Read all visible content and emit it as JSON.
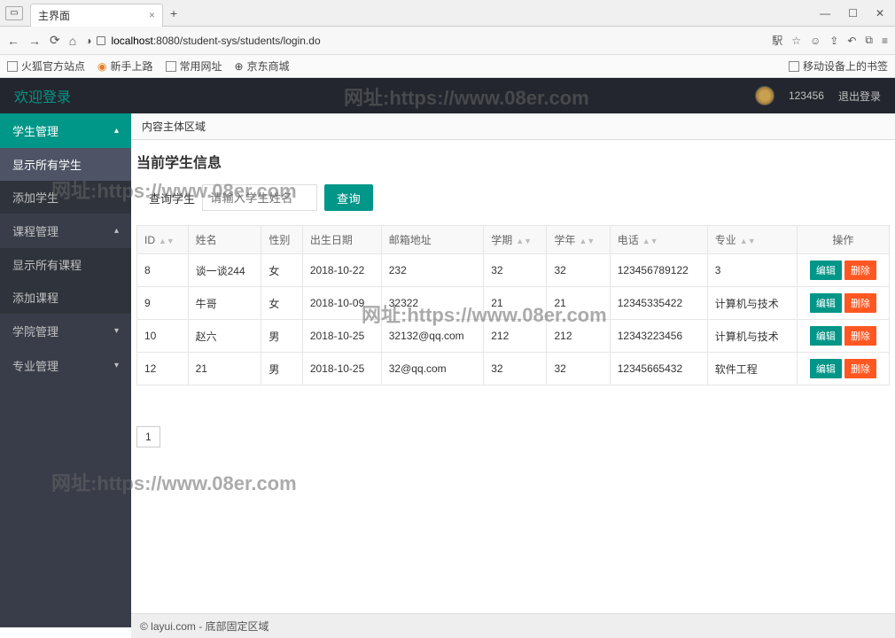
{
  "browser": {
    "tab_title": "主界面",
    "url_display_prefix": "localhost",
    "url_display_rest": ":8080/student-sys/students/login.do",
    "bookmarks": [
      "火狐官方站点",
      "新手上路",
      "常用网址",
      "京东商城"
    ],
    "right_bookmark": "移动设备上的书签"
  },
  "header": {
    "title": "欢迎登录",
    "username": "123456",
    "logout": "退出登录"
  },
  "sidebar": {
    "items": [
      {
        "label": "学生管理",
        "type": "top",
        "arrow": "▴"
      },
      {
        "label": "显示所有学生",
        "type": "active"
      },
      {
        "label": "添加学生",
        "type": "sub"
      },
      {
        "label": "课程管理",
        "type": "group",
        "arrow": "▴"
      },
      {
        "label": "显示所有课程",
        "type": "sub"
      },
      {
        "label": "添加课程",
        "type": "sub"
      },
      {
        "label": "学院管理",
        "type": "group",
        "arrow": "▾"
      },
      {
        "label": "专业管理",
        "type": "group",
        "arrow": "▾"
      }
    ]
  },
  "content": {
    "tab": "内容主体区域",
    "title": "当前学生信息",
    "search_label": "查询学生",
    "search_placeholder": "请输入学生姓名",
    "search_btn": "查询"
  },
  "table": {
    "headers": [
      "ID",
      "姓名",
      "性别",
      "出生日期",
      "邮箱地址",
      "学期",
      "学年",
      "电话",
      "专业",
      "操作"
    ],
    "rows": [
      {
        "id": "8",
        "name": "谈一谈244",
        "sex": "女",
        "dob": "2018-10-22",
        "email": "232",
        "term": "32",
        "year": "32",
        "phone": "123456789122",
        "major": "3"
      },
      {
        "id": "9",
        "name": "牛哥",
        "sex": "女",
        "dob": "2018-10-09",
        "email": "32322",
        "term": "21",
        "year": "21",
        "phone": "12345335422",
        "major": "计算机与技术"
      },
      {
        "id": "10",
        "name": "赵六",
        "sex": "男",
        "dob": "2018-10-25",
        "email": "32132@qq.com",
        "term": "212",
        "year": "212",
        "phone": "12343223456",
        "major": "计算机与技术"
      },
      {
        "id": "12",
        "name": "21",
        "sex": "男",
        "dob": "2018-10-25",
        "email": "32@qq.com",
        "term": "32",
        "year": "32",
        "phone": "12345665432",
        "major": "软件工程"
      }
    ],
    "edit_label": "编辑",
    "del_label": "删除"
  },
  "pager": {
    "current": "1"
  },
  "footer": "© layui.com - 底部固定区域",
  "watermark": "网址:https://www.08er.com"
}
